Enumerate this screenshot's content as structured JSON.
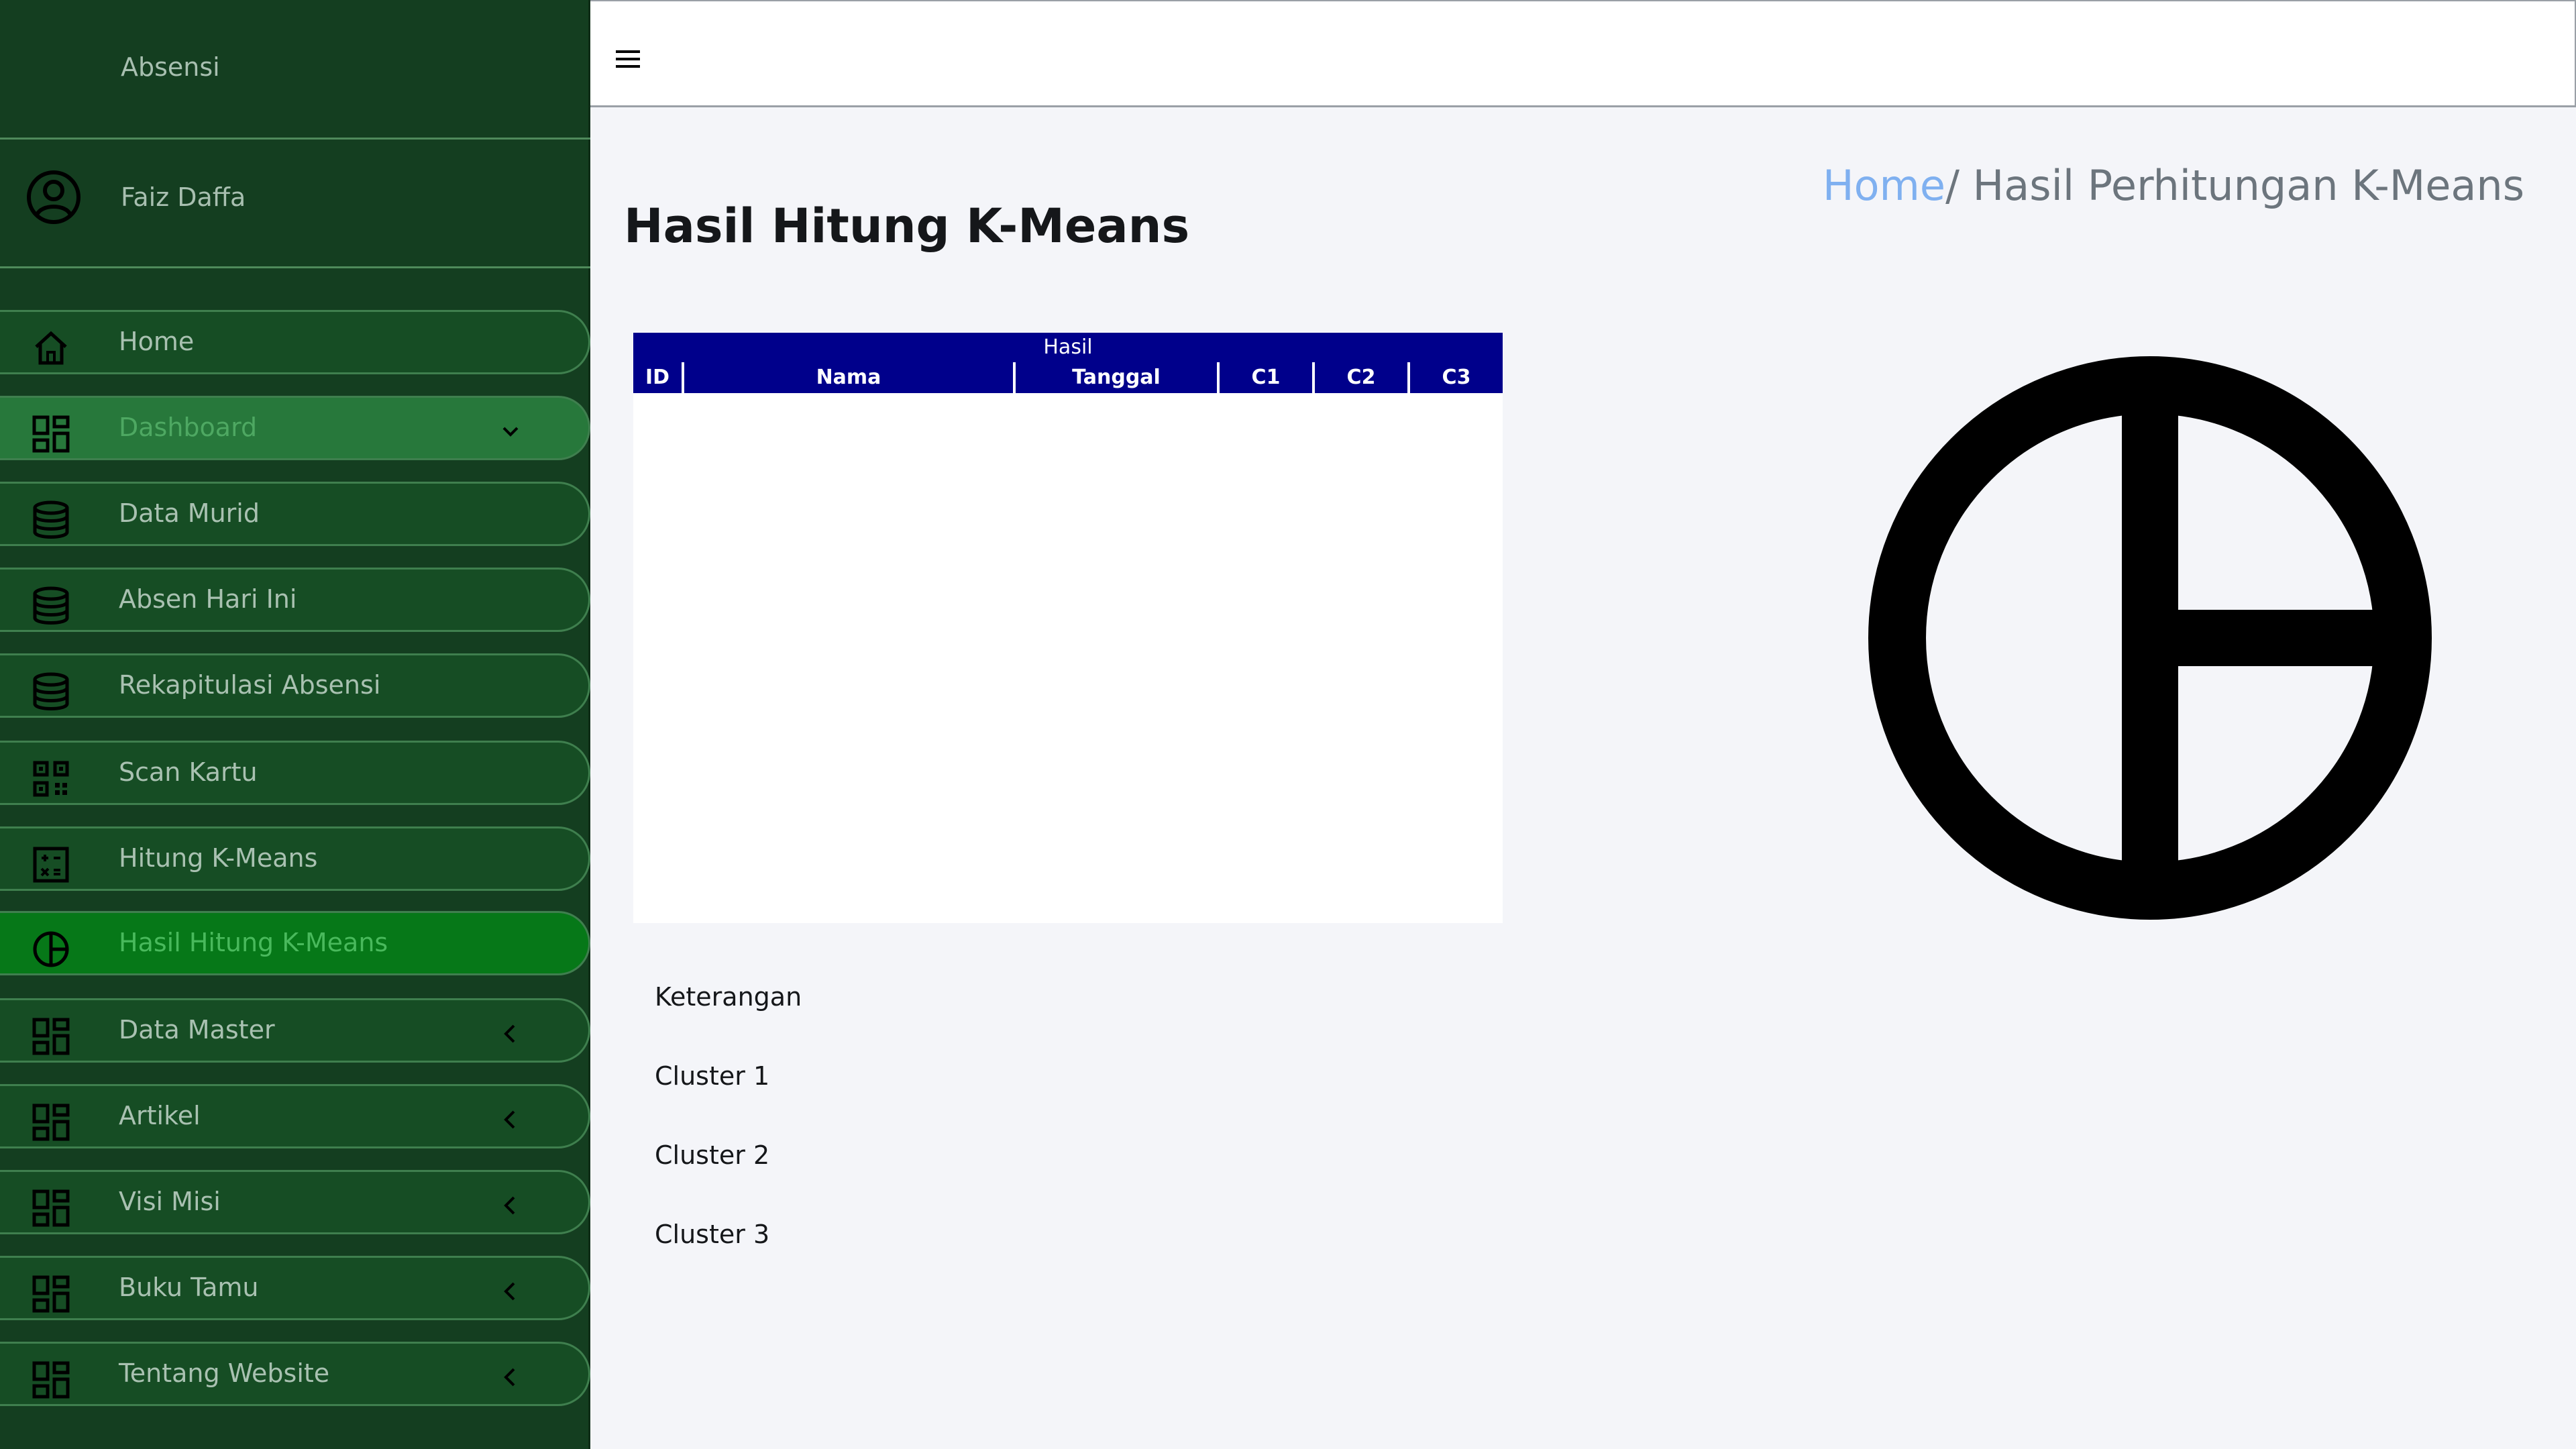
{
  "sidebar": {
    "brand": "Absensi",
    "user_name": "Faiz Daffa",
    "items": [
      {
        "label": "Home",
        "icon": "home-icon"
      },
      {
        "label": "Dashboard",
        "icon": "dashboard-icon",
        "expanded": true
      },
      {
        "label": "Data Murid",
        "icon": "database-icon"
      },
      {
        "label": "Absen Hari Ini",
        "icon": "database-icon"
      },
      {
        "label": "Rekapitulasi Absensi",
        "icon": "database-icon"
      },
      {
        "label": "Scan Kartu",
        "icon": "qrcode-icon"
      },
      {
        "label": "Hitung K-Means",
        "icon": "calculator-icon"
      },
      {
        "label": "Hasil Hitung K-Means",
        "icon": "pie-chart-icon",
        "active": true
      },
      {
        "label": "Data Master",
        "icon": "dashboard-icon"
      },
      {
        "label": "Artikel",
        "icon": "dashboard-icon"
      },
      {
        "label": "Visi Misi",
        "icon": "dashboard-icon"
      },
      {
        "label": "Buku Tamu",
        "icon": "dashboard-icon"
      },
      {
        "label": "Tentang Website",
        "icon": "dashboard-icon"
      }
    ]
  },
  "topbar": {
    "menu_icon": "hamburger-icon"
  },
  "main": {
    "title": "Hasil Hitung K-Means",
    "breadcrumb": {
      "home": "Home",
      "current": "/ Hasil Perhitungan K-Means"
    },
    "table": {
      "caption": "Hasil",
      "columns": [
        "ID",
        "Nama",
        "Tanggal",
        "C1",
        "C2",
        "C3"
      ],
      "rows": []
    },
    "legend": {
      "title": "Keterangan",
      "items": [
        "Cluster 1",
        "Cluster 2",
        "Cluster 3"
      ]
    }
  },
  "colors": {
    "sidebar_bg": "#143e20",
    "active_item": "#067818",
    "table_header": "#00008b",
    "breadcrumb_link": "#7fb0f0"
  }
}
